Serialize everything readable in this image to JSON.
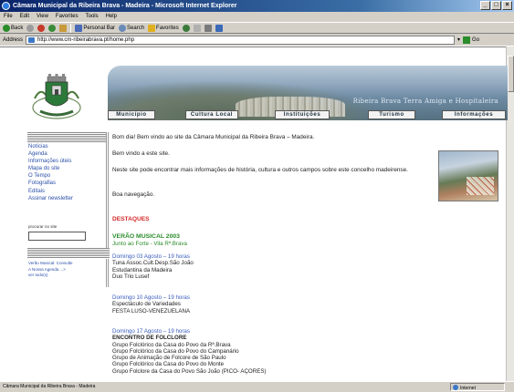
{
  "window": {
    "title": "Câmara Municipal da Ribeira Brava - Madeira - Microsoft Internet Explorer",
    "controls": [
      "_",
      "□",
      "×"
    ]
  },
  "menubar": [
    "File",
    "Edit",
    "View",
    "Favorites",
    "Tools",
    "Help"
  ],
  "toolbar": {
    "back": "Back",
    "search": "Search",
    "favorites": "Favorites",
    "personal_bar": "Personal Bar"
  },
  "addressbar": {
    "label": "Address",
    "url": "http://www.cm-ribeirabrava.pt/home.php",
    "go": "Go"
  },
  "banner": {
    "slogan": "Ribeira Brava Terra Amiga e Hospitaleira"
  },
  "nav": [
    "Município",
    "Cultura Local",
    "Instituições",
    "Turismo",
    "Informações"
  ],
  "sidebar": {
    "menu": [
      "Notícias",
      "Agenda",
      "Informações úteis",
      "Mapa do site",
      "O Tempo",
      "Fotografias",
      "Editais",
      "Assinar newsletter"
    ],
    "search_label": "procurar no site",
    "search_value": "",
    "ticker": [
      "Verão Musical: Consulte",
      "A Nossa Agenda ...>",
      "ver todo(s)"
    ]
  },
  "main": {
    "greeting": "Bom dia! Bem vindo ao site da Câmara Municipal da Ribeira Brava – Madeira.",
    "welcome": "Bem vindo a este site.",
    "info": "Neste site pode encontrar mais informações de história, cultura e outros campos sobre este concelho madeirense.",
    "farewell": "Boa navegação."
  },
  "highlights": {
    "heading": "DESTAQUES",
    "event_title": "VERÃO MUSICAL 2003",
    "event_subtitle": "Junto ao Forte - Vila Rª.Brava",
    "blocks": [
      {
        "date": "Domingo 03 Agosto – 19 horas",
        "lines": [
          "Tuna Assoc.Cult.Desp.São João",
          "Estudantina da Madeira",
          "Duo Trio Lusef"
        ]
      },
      {
        "date": "Domingo 10 Agosto – 19 horas",
        "lines": [
          "Espectáculo de Variedades",
          "FESTA LUSO-VENEZUELANA"
        ]
      },
      {
        "date": "Domingo 17 Agosto – 19 horas",
        "lead": "ENCONTRO DE FOLCLORE",
        "lines": [
          "Grupo Folclórico da Casa do Povo da Rª.Brava",
          "Grupo Folclórico da Casa do Povo do Campanário",
          "Grupo de Animação de Folcore de São Paulo",
          "Grupo Folclórico da Casa do Povo do Monte",
          "Grupo Folclore da Casa do Povo São João (PICO- AÇORES)"
        ]
      }
    ]
  },
  "statusbar": {
    "text": "Câmara Municipal da Ribeira Brava - Madeira",
    "zone": "Internet"
  },
  "colors": {
    "link": "#2a4fa8",
    "highlight_red": "#d42a2a",
    "event_green": "#2a8c2a",
    "date_blue": "#3a5ec0"
  }
}
